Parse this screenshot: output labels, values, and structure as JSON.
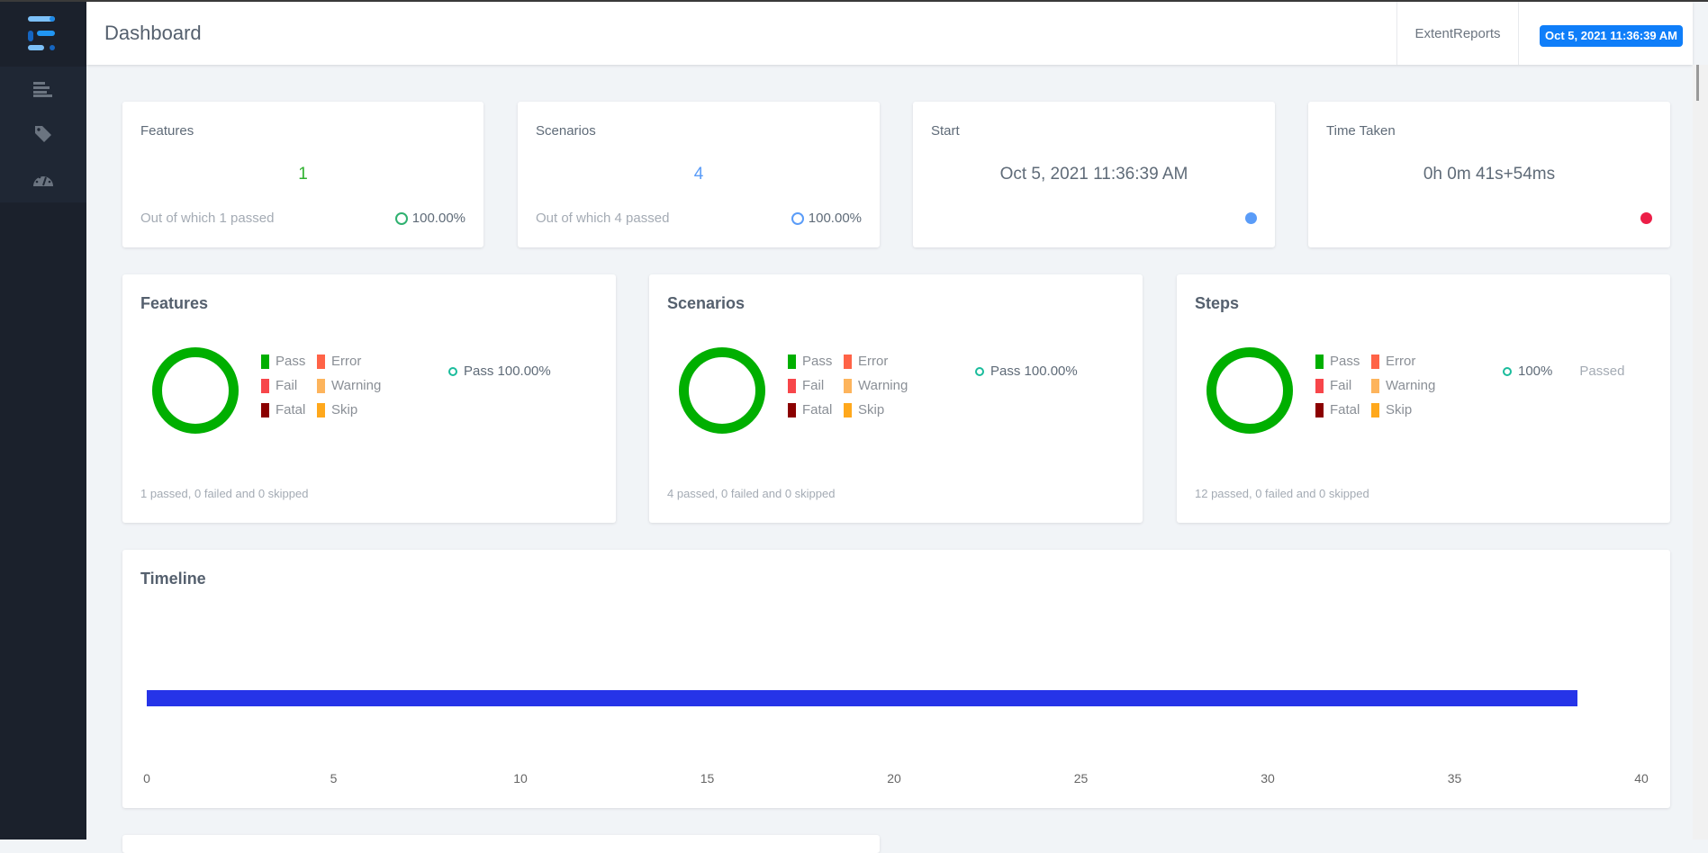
{
  "header": {
    "title": "Dashboard",
    "brand": "ExtentReports",
    "timestamp": "Oct 5, 2021 11:36:39 AM"
  },
  "sidebar": {
    "items": [
      {
        "icon": "list-icon"
      },
      {
        "icon": "tag-icon"
      },
      {
        "icon": "dashboard-icon"
      }
    ]
  },
  "summary": [
    {
      "title": "Features",
      "value": "1",
      "footer": "Out of which 1 passed",
      "percent": "100.00%",
      "color": "#2fb12f"
    },
    {
      "title": "Scenarios",
      "value": "4",
      "footer": "Out of which 4 passed",
      "percent": "100.00%",
      "color": "#5a9cf8"
    },
    {
      "title": "Start",
      "value": "Oct 5, 2021 11:36:39 AM",
      "dot_color": "#5a9cf8"
    },
    {
      "title": "Time Taken",
      "value": "0h 0m 41s+54ms",
      "dot_color": "#ec1e47"
    }
  ],
  "legend": [
    {
      "label": "Pass",
      "color": "#00af00"
    },
    {
      "label": "Error",
      "color": "#ff6347"
    },
    {
      "label": "Fail",
      "color": "#f7464a"
    },
    {
      "label": "Warning",
      "color": "#fdb45c"
    },
    {
      "label": "Fatal",
      "color": "#8b0000"
    },
    {
      "label": "Skip",
      "color": "#ffa81c"
    }
  ],
  "charts": [
    {
      "title": "Features",
      "note": "Pass 100.00%",
      "note_sub": "",
      "footer": "1 passed, 0 failed and 0 skipped",
      "pass": 1,
      "fail": 0,
      "skip": 0
    },
    {
      "title": "Scenarios",
      "note": "Pass 100.00%",
      "note_sub": "",
      "footer": "4 passed, 0 failed and 0 skipped",
      "pass": 4,
      "fail": 0,
      "skip": 0
    },
    {
      "title": "Steps",
      "note": "100%",
      "note_sub": "Passed",
      "footer": "12 passed, 0 failed and 0 skipped",
      "pass": 12,
      "fail": 0,
      "skip": 0
    }
  ],
  "timeline": {
    "title": "Timeline",
    "chart_data": {
      "type": "bar",
      "orientation": "horizontal",
      "xlim": [
        0,
        40
      ],
      "xticks": [
        "0",
        "5",
        "10",
        "15",
        "20",
        "25",
        "30",
        "35",
        "40"
      ],
      "bars": [
        {
          "start": 0,
          "end": 38.3,
          "color": "#2634e8"
        }
      ],
      "grid": false
    }
  }
}
